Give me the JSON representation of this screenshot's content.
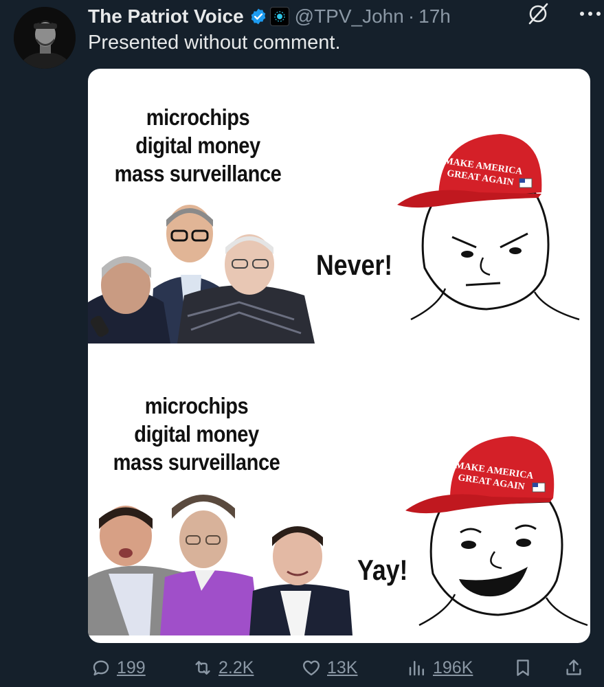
{
  "post": {
    "display_name": "The Patriot Voice",
    "handle": "@TPV_John",
    "separator": "·",
    "time": "17h",
    "text": "Presented without comment."
  },
  "media": {
    "top": {
      "caption": [
        "microchips",
        "digital money",
        "mass surveillance"
      ],
      "reaction": "Never!",
      "hat_text": [
        "MAKE AMERICA",
        "GREAT AGAIN"
      ]
    },
    "bottom": {
      "caption": [
        "microchips",
        "digital money",
        "mass surveillance"
      ],
      "reaction": "Yay!",
      "hat_text": [
        "MAKE AMERICA",
        "GREAT AGAIN"
      ]
    }
  },
  "actions": {
    "replies": "199",
    "reposts": "2.2K",
    "likes": "13K",
    "views": "196K"
  },
  "icons": [
    "verified-badge-icon",
    "affiliate-badge-icon",
    "grok-icon",
    "more-icon",
    "reply-icon",
    "repost-icon",
    "like-icon",
    "views-icon",
    "bookmark-icon",
    "share-icon"
  ],
  "colors": {
    "background": "#15202b",
    "text": "#e7e9ea",
    "muted": "#8b98a5",
    "verified": "#1d9bf0",
    "hat_red": "#d42028"
  }
}
